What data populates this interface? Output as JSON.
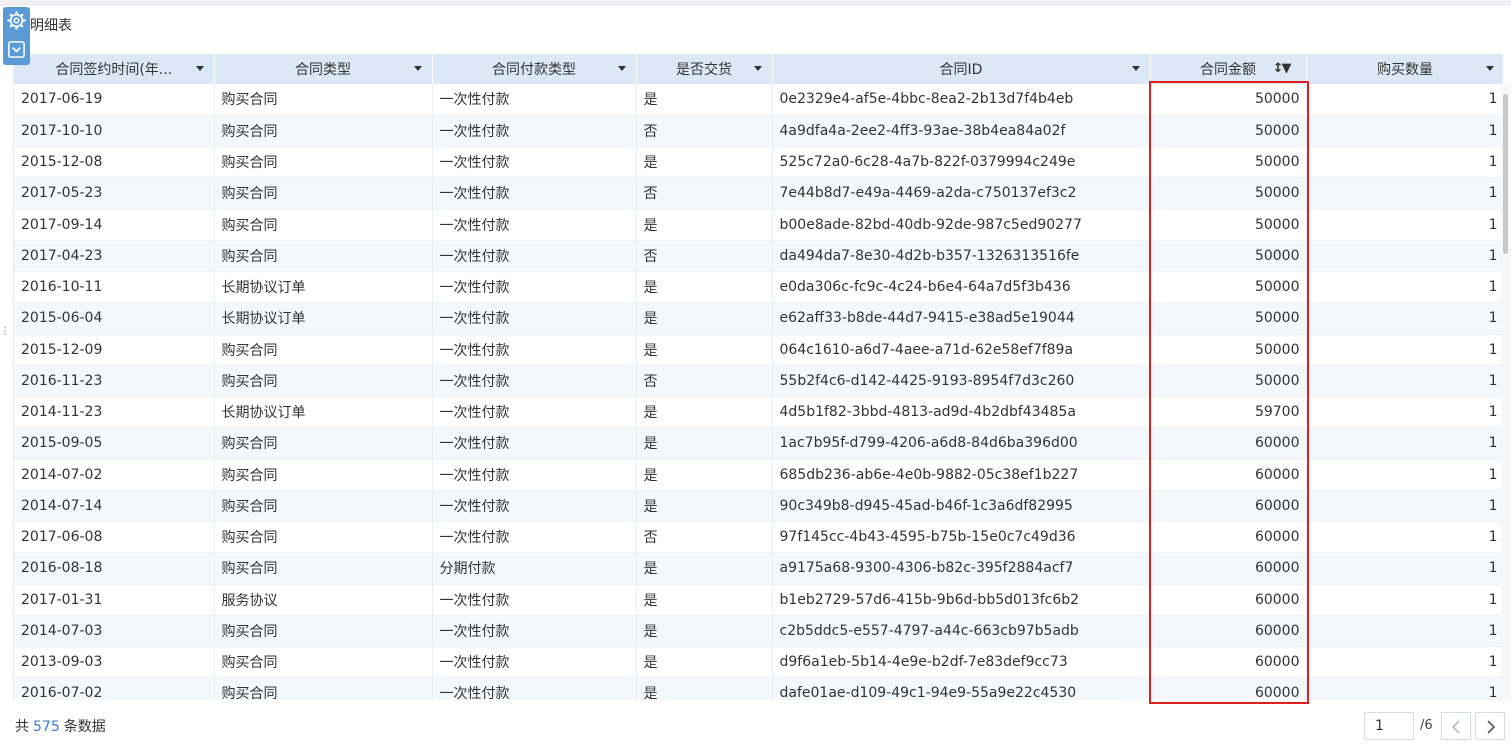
{
  "widget": {
    "title": "明细表"
  },
  "tools": {
    "settings_icon": "gear-icon",
    "collapse_icon": "chevron-down-box-icon"
  },
  "table": {
    "columns": [
      {
        "label": "合同签约时间(年...",
        "control": "caret"
      },
      {
        "label": "合同类型",
        "control": "caret"
      },
      {
        "label": "合同付款类型",
        "control": "caret"
      },
      {
        "label": "是否交货",
        "control": "caret"
      },
      {
        "label": "合同ID",
        "control": "caret"
      },
      {
        "label": "合同金额",
        "control": "sort-filter"
      },
      {
        "label": "购买数量",
        "control": "caret"
      }
    ],
    "rows": [
      [
        "2017-06-19",
        "购买合同",
        "一次性付款",
        "是",
        "0e2329e4-af5e-4bbc-8ea2-2b13d7f4b4eb",
        "50000",
        "1"
      ],
      [
        "2017-10-10",
        "购买合同",
        "一次性付款",
        "否",
        "4a9dfa4a-2ee2-4ff3-93ae-38b4ea84a02f",
        "50000",
        "1"
      ],
      [
        "2015-12-08",
        "购买合同",
        "一次性付款",
        "是",
        "525c72a0-6c28-4a7b-822f-0379994c249e",
        "50000",
        "1"
      ],
      [
        "2017-05-23",
        "购买合同",
        "一次性付款",
        "否",
        "7e44b8d7-e49a-4469-a2da-c750137ef3c2",
        "50000",
        "1"
      ],
      [
        "2017-09-14",
        "购买合同",
        "一次性付款",
        "是",
        "b00e8ade-82bd-40db-92de-987c5ed90277",
        "50000",
        "1"
      ],
      [
        "2017-04-23",
        "购买合同",
        "一次性付款",
        "否",
        "da494da7-8e30-4d2b-b357-1326313516fe",
        "50000",
        "1"
      ],
      [
        "2016-10-11",
        "长期协议订单",
        "一次性付款",
        "是",
        "e0da306c-fc9c-4c24-b6e4-64a7d5f3b436",
        "50000",
        "1"
      ],
      [
        "2015-06-04",
        "长期协议订单",
        "一次性付款",
        "是",
        "e62aff33-b8de-44d7-9415-e38ad5e19044",
        "50000",
        "1"
      ],
      [
        "2015-12-09",
        "购买合同",
        "一次性付款",
        "是",
        "064c1610-a6d7-4aee-a71d-62e58ef7f89a",
        "50000",
        "1"
      ],
      [
        "2016-11-23",
        "购买合同",
        "一次性付款",
        "否",
        "55b2f4c6-d142-4425-9193-8954f7d3c260",
        "50000",
        "1"
      ],
      [
        "2014-11-23",
        "长期协议订单",
        "一次性付款",
        "是",
        "4d5b1f82-3bbd-4813-ad9d-4b2dbf43485a",
        "59700",
        "1"
      ],
      [
        "2015-09-05",
        "购买合同",
        "一次性付款",
        "是",
        "1ac7b95f-d799-4206-a6d8-84d6ba396d00",
        "60000",
        "1"
      ],
      [
        "2014-07-02",
        "购买合同",
        "一次性付款",
        "是",
        "685db236-ab6e-4e0b-9882-05c38ef1b227",
        "60000",
        "1"
      ],
      [
        "2014-07-14",
        "购买合同",
        "一次性付款",
        "是",
        "90c349b8-d945-45ad-b46f-1c3a6df82995",
        "60000",
        "1"
      ],
      [
        "2017-06-08",
        "购买合同",
        "一次性付款",
        "否",
        "97f145cc-4b43-4595-b75b-15e0c7c49d36",
        "60000",
        "1"
      ],
      [
        "2016-08-18",
        "购买合同",
        "分期付款",
        "是",
        "a9175a68-9300-4306-b82c-395f2884acf7",
        "60000",
        "1"
      ],
      [
        "2017-01-31",
        "服务协议",
        "一次性付款",
        "是",
        "b1eb2729-57d6-415b-9b6d-bb5d013fc6b2",
        "60000",
        "1"
      ],
      [
        "2014-07-03",
        "购买合同",
        "一次性付款",
        "是",
        "c2b5ddc5-e557-4797-a44c-663cb97b5adb",
        "60000",
        "1"
      ],
      [
        "2013-09-03",
        "购买合同",
        "一次性付款",
        "是",
        "d9f6a1eb-5b14-4e9e-b2df-7e83def9cc73",
        "60000",
        "1"
      ],
      [
        "2016-07-02",
        "购买合同",
        "一次性付款",
        "是",
        "dafe01ae-d109-49c1-94e9-55a9e22c4530",
        "60000",
        "1"
      ]
    ]
  },
  "footer": {
    "prefix": "共",
    "count": "575",
    "suffix": "条数据",
    "page_value": "1",
    "page_total": "/6"
  }
}
